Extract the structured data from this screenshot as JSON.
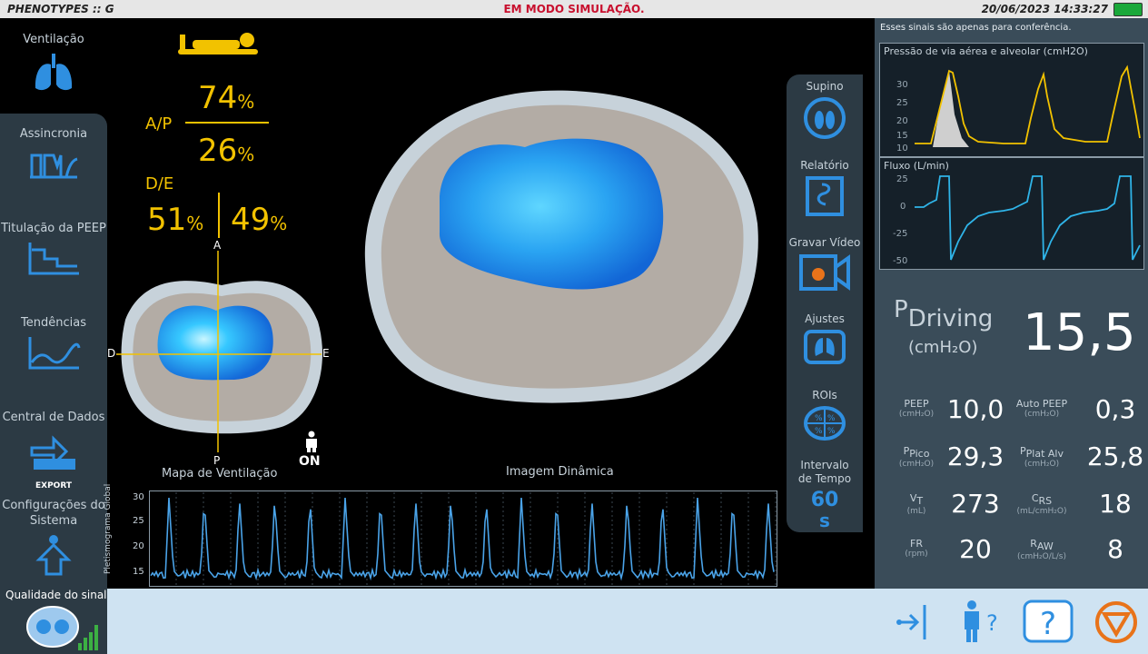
{
  "topbar": {
    "app_title": "PHENOTYPES :: G",
    "simulation": "EM MODO SIMULAÇÃO.",
    "datetime": "20/06/2023 14:33:27"
  },
  "sidebar": {
    "items": [
      {
        "label": "Ventilação",
        "icon": "lungs-icon"
      },
      {
        "label": "Assincronia",
        "icon": "asynchrony-wave-icon"
      },
      {
        "label": "Titulação da PEEP",
        "icon": "peep-steps-icon"
      },
      {
        "label": "Tendências",
        "icon": "trend-chart-icon"
      },
      {
        "label": "Central de Dados",
        "icon": "export-icon"
      },
      {
        "label": "Configurações do Sistema",
        "icon": "person-arrow-icon"
      }
    ],
    "export_text": "EXPORT"
  },
  "signal_quality": {
    "label": "Qualidade do sinal"
  },
  "ventilation_map": {
    "ap_label": "A/P",
    "anterior": "74",
    "posterior": "26",
    "de_label": "D/E",
    "right": "51",
    "left": "49",
    "percent": "%",
    "axis_a": "A",
    "axis_p": "P",
    "axis_d": "D",
    "axis_e": "E",
    "caption": "Mapa de Ventilação",
    "on_label": "ON"
  },
  "dynamic_image": {
    "caption": "Imagem Dinâmica"
  },
  "pleth": {
    "ylabel": "Pletismograma Global",
    "yticks": [
      "30",
      "25",
      "20",
      "15"
    ]
  },
  "tools": {
    "supino": "Supino",
    "relatorio": "Relatório",
    "gravar": "Gravar Vídeo",
    "ajustes": "Ajustes",
    "rois": "ROIs",
    "intervalo_l1": "Intervalo",
    "intervalo_l2": "de Tempo",
    "intervalo_value": "60",
    "intervalo_unit": "s"
  },
  "right": {
    "note": "Esses sinais são apenas para conferência.",
    "pressure_title": "Pressão de via aérea e alveolar (cmH2O)",
    "pressure_ticks": [
      "30",
      "25",
      "20",
      "15",
      "10"
    ],
    "flow_title": "Fluxo (L/min)",
    "flow_ticks": [
      "25",
      "0",
      "-25",
      "-50"
    ],
    "pdriving_p": "P",
    "pdriving_sub": "Driving",
    "pdriving_unit": "(cmH₂O)",
    "pdriving_value": "15,5",
    "params": [
      {
        "label": "PEEP",
        "sub": "",
        "unit": "(cmH₂O)",
        "value": "10,0"
      },
      {
        "label": "Auto PEEP",
        "sub": "",
        "unit": "(cmH₂O)",
        "value": "0,3"
      },
      {
        "label": "P",
        "sub": "Pico",
        "unit": "(cmH₂O)",
        "value": "29,3"
      },
      {
        "label": "P",
        "sub": "Plat Alv",
        "unit": "(cmH₂O)",
        "value": "25,8"
      },
      {
        "label": "V",
        "sub": "T",
        "unit": "(mL)",
        "value": "273"
      },
      {
        "label": "C",
        "sub": "RS",
        "unit": "(mL/cmH₂O)",
        "value": "18"
      },
      {
        "label": "FR",
        "sub": "",
        "unit": "(rpm)",
        "value": "20"
      },
      {
        "label": "R",
        "sub": "AW",
        "unit": "(cmH₂O/L/s)",
        "value": "8"
      }
    ]
  },
  "colors": {
    "accent_blue": "#2f8fe0",
    "yellow": "#f2c200",
    "warning_orange": "#e8731a",
    "sim_red": "#c8102e"
  }
}
